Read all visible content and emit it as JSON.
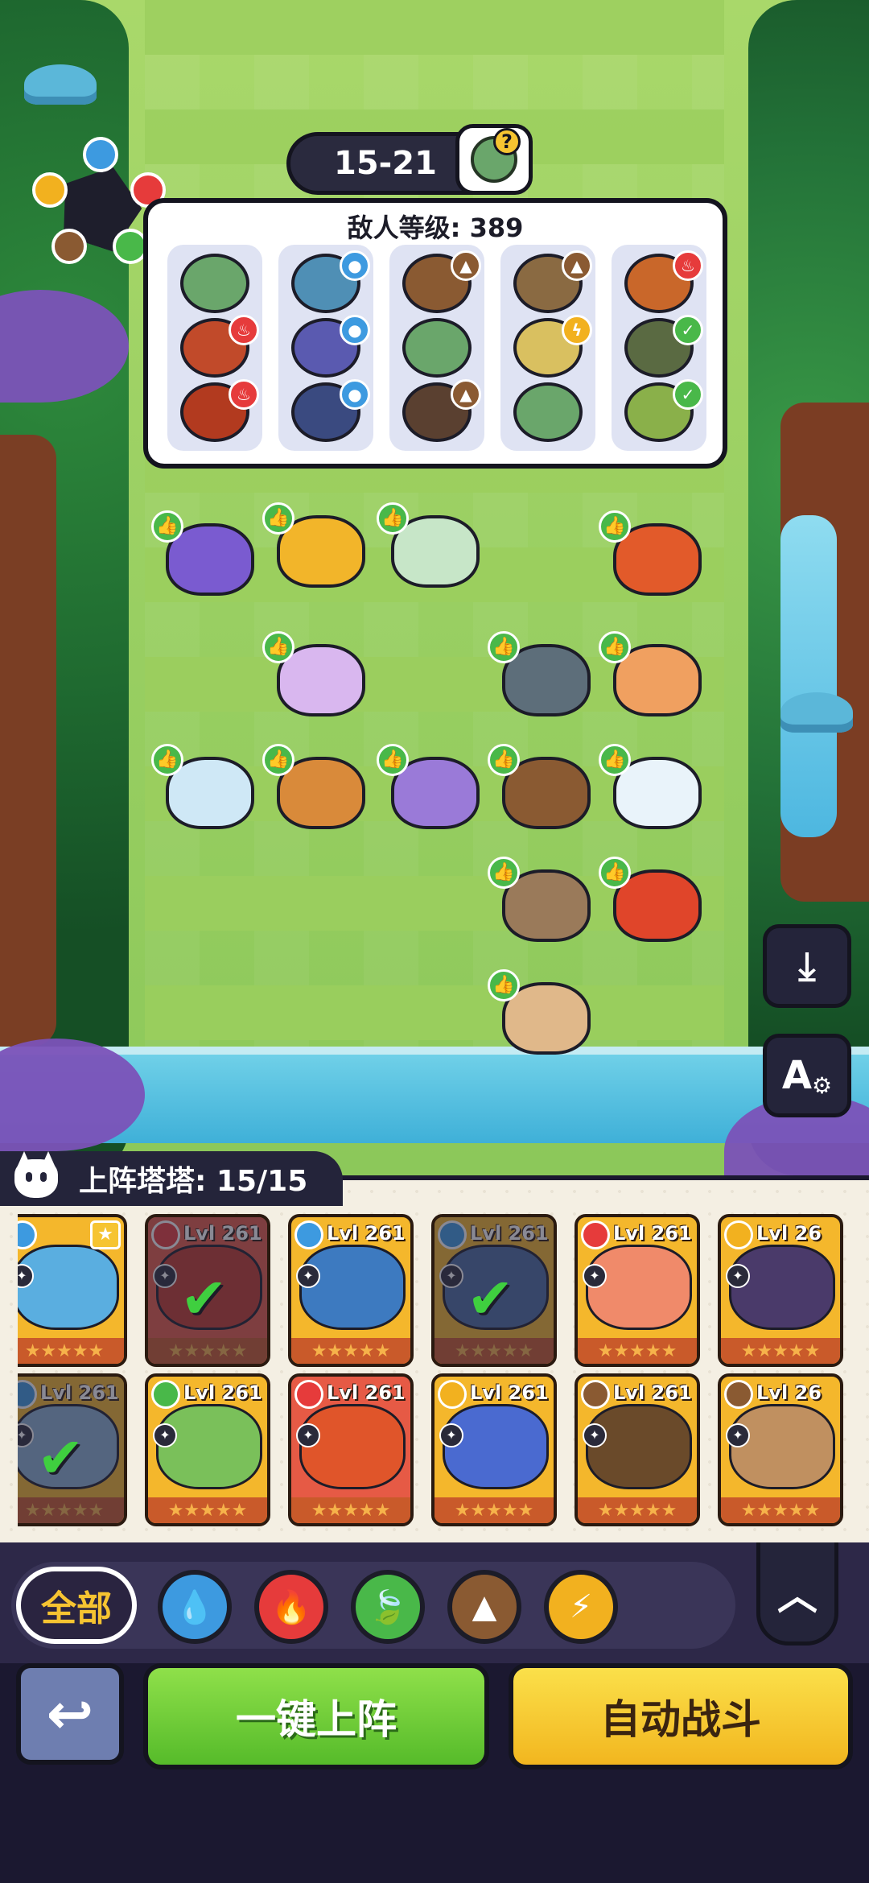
{
  "stage": {
    "label": "15-21",
    "boss_icon": "zombie-question-icon"
  },
  "element_wheel": {
    "nodes": [
      {
        "name": "water-icon",
        "color": "#3d9ae0"
      },
      {
        "name": "fire-icon",
        "color": "#e63b3b"
      },
      {
        "name": "leaf-icon",
        "color": "#49b849"
      },
      {
        "name": "earth-icon",
        "color": "#8a5a32"
      },
      {
        "name": "lightning-icon",
        "color": "#f2b11f"
      }
    ]
  },
  "enemy_panel": {
    "title": "敌人等级: 389",
    "columns": [
      {
        "enemies": [
          {
            "elem": "none",
            "color": "#6aa66b",
            "elem_color": ""
          },
          {
            "elem": "fire",
            "color": "#c14a2a",
            "elem_color": "#e63b3b"
          },
          {
            "elem": "fire",
            "color": "#b23a1f",
            "elem_color": "#e63b3b"
          }
        ]
      },
      {
        "enemies": [
          {
            "elem": "water",
            "color": "#4f8fb5",
            "elem_color": "#3d9ae0"
          },
          {
            "elem": "water",
            "color": "#5a5ab0",
            "elem_color": "#3d9ae0"
          },
          {
            "elem": "water",
            "color": "#3a4a80",
            "elem_color": "#3d9ae0"
          }
        ]
      },
      {
        "enemies": [
          {
            "elem": "earth",
            "color": "#8a5a32",
            "elem_color": "#8a5a32"
          },
          {
            "elem": "none",
            "color": "#6aa66b",
            "elem_color": ""
          },
          {
            "elem": "earth",
            "color": "#5a4030",
            "elem_color": "#8a5a32"
          }
        ]
      },
      {
        "enemies": [
          {
            "elem": "earth",
            "color": "#8a6a42",
            "elem_color": "#8a5a32"
          },
          {
            "elem": "lightning",
            "color": "#d9c060",
            "elem_color": "#f2b11f"
          },
          {
            "elem": "none",
            "color": "#6aa66b",
            "elem_color": ""
          }
        ]
      },
      {
        "enemies": [
          {
            "elem": "fire",
            "color": "#c9672a",
            "elem_color": "#e63b3b"
          },
          {
            "elem": "leaf",
            "color": "#5a6a42",
            "elem_color": "#49b849"
          },
          {
            "elem": "leaf",
            "color": "#8ab04a",
            "elem_color": "#49b849"
          }
        ]
      }
    ]
  },
  "field_units": [
    {
      "name": "unit-purple-bird",
      "color": "#7a5bd0"
    },
    {
      "name": "unit-yellow-fox",
      "color": "#f2b52a"
    },
    {
      "name": "unit-green-fairy",
      "color": "#c7e6c8"
    },
    {
      "name": "unit-black-lion",
      "color": "#e25a2a"
    },
    {
      "name": "unit-star-pony",
      "color": "#d9b7ef"
    },
    {
      "name": "unit-purple-trex",
      "color": "#5d6e7a"
    },
    {
      "name": "unit-fire-bunny",
      "color": "#f0a060"
    },
    {
      "name": "unit-ice-serpent",
      "color": "#cfe8f6"
    },
    {
      "name": "unit-orange-dog",
      "color": "#d98a3a"
    },
    {
      "name": "unit-butterfly-dragon",
      "color": "#9a7ad8"
    },
    {
      "name": "unit-rock-turtle",
      "color": "#8a5a32"
    },
    {
      "name": "unit-water-spirit",
      "color": "#e9f3fa"
    },
    {
      "name": "unit-goggle-otter",
      "color": "#9a7a5a"
    },
    {
      "name": "unit-red-dragon",
      "color": "#e0452a"
    },
    {
      "name": "unit-snake",
      "color": "#e0b88a"
    }
  ],
  "side_buttons": {
    "save_icon": "download-icon",
    "settings_label": "A",
    "settings_icon": "auto-settings-icon"
  },
  "roster": {
    "label": "上阵塔塔: 15/15",
    "cards": [
      {
        "level": "",
        "elem_color": "#3d9ae0",
        "portrait": "#5aaee0",
        "bg": "#f4b72c",
        "deployed": false,
        "dim": false,
        "crown": true
      },
      {
        "level": "Lvl 261",
        "elem_color": "#e63b3b",
        "portrait": "#c0392b",
        "bg": "#e65a45",
        "deployed": true,
        "dim": true,
        "crown": false
      },
      {
        "level": "Lvl 261",
        "elem_color": "#3d9ae0",
        "portrait": "#3d7ac0",
        "bg": "#f4b72c",
        "deployed": false,
        "dim": false,
        "crown": false
      },
      {
        "level": "Lvl 261",
        "elem_color": "#3d9ae0",
        "portrait": "#4a6aa0",
        "bg": "#f4b72c",
        "deployed": true,
        "dim": true,
        "crown": false
      },
      {
        "level": "Lvl 261",
        "elem_color": "#e63b3b",
        "portrait": "#f08a6a",
        "bg": "#f4b72c",
        "deployed": false,
        "dim": false,
        "crown": false
      },
      {
        "level": "Lvl 26",
        "elem_color": "#f2b11f",
        "portrait": "#4a3a6a",
        "bg": "#f4b72c",
        "deployed": false,
        "dim": false,
        "crown": false
      },
      {
        "level": "Lvl 261",
        "elem_color": "#3d9ae0",
        "portrait": "#8ab0d0",
        "bg": "#f4b72c",
        "deployed": true,
        "dim": true,
        "crown": false
      },
      {
        "level": "Lvl 261",
        "elem_color": "#49b849",
        "portrait": "#7ac05a",
        "bg": "#f4b72c",
        "deployed": false,
        "dim": false,
        "crown": false
      },
      {
        "level": "Lvl 261",
        "elem_color": "#e63b3b",
        "portrait": "#e0552a",
        "bg": "#e65a45",
        "deployed": false,
        "dim": false,
        "crown": false
      },
      {
        "level": "Lvl 261",
        "elem_color": "#f2b11f",
        "portrait": "#4a6ad0",
        "bg": "#f4b72c",
        "deployed": false,
        "dim": false,
        "crown": false
      },
      {
        "level": "Lvl 261",
        "elem_color": "#8a5a32",
        "portrait": "#6a4a2a",
        "bg": "#f4b72c",
        "deployed": false,
        "dim": false,
        "crown": false
      },
      {
        "level": "Lvl 26",
        "elem_color": "#8a5a32",
        "portrait": "#c09060",
        "bg": "#f4b72c",
        "deployed": false,
        "dim": false,
        "crown": false
      }
    ]
  },
  "filters": {
    "all_label": "全部",
    "elements": [
      {
        "name": "filter-water-button",
        "icon": "water-drop-icon",
        "color": "#3d9ae0"
      },
      {
        "name": "filter-fire-button",
        "icon": "flame-icon",
        "color": "#e63b3b"
      },
      {
        "name": "filter-leaf-button",
        "icon": "leaf-icon",
        "color": "#49b849"
      },
      {
        "name": "filter-earth-button",
        "icon": "mountain-icon",
        "color": "#8a5a32"
      },
      {
        "name": "filter-lightning-button",
        "icon": "lightning-icon",
        "color": "#f2b11f"
      }
    ],
    "collapse_icon": "chevron-up-icon"
  },
  "actions": {
    "back_icon": "return-arrow-icon",
    "deploy_all": "一键上阵",
    "auto_battle": "自动战斗"
  }
}
